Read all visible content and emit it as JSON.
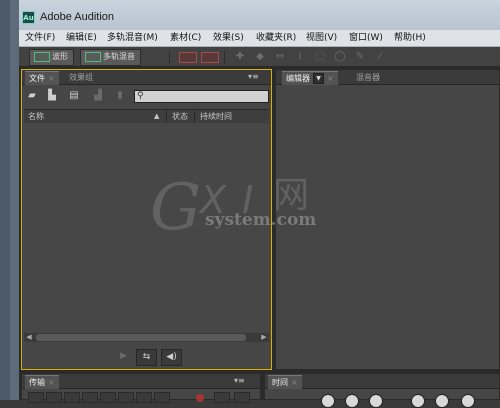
{
  "window": {
    "title": "Adobe Audition",
    "icon_text": "Au"
  },
  "menu": [
    {
      "id": "file",
      "label": "文件(F)"
    },
    {
      "id": "edit",
      "label": "编辑(E)"
    },
    {
      "id": "multitrack",
      "label": "多轨混音(M)"
    },
    {
      "id": "clip",
      "label": "素材(C)"
    },
    {
      "id": "effects",
      "label": "效果(S)"
    },
    {
      "id": "favorites",
      "label": "收藏夹(R)"
    },
    {
      "id": "view",
      "label": "视图(V)"
    },
    {
      "id": "window",
      "label": "窗口(W)"
    },
    {
      "id": "help",
      "label": "帮助(H)"
    }
  ],
  "toolbar": {
    "waveform_label": "波形",
    "multitrack_label": "多轨混音",
    "icons": [
      "spectral-frequency-icon",
      "spectral-pitch-icon",
      "move-tool-icon",
      "razor-tool-icon",
      "slip-tool-icon",
      "time-selection-icon",
      "marquee-tool-icon",
      "lasso-tool-icon",
      "brush-tool-icon",
      "spot-healing-icon"
    ]
  },
  "files_panel": {
    "tabs": [
      {
        "label": "文件",
        "active": true
      },
      {
        "label": "效果组",
        "active": false
      }
    ],
    "panel_menu": "▾≡",
    "tool_icons": [
      "open-folder-icon",
      "import-icon",
      "new-file-icon",
      "insert-icon",
      "delete-icon"
    ],
    "search_placeholder": "",
    "columns": {
      "name": "名称",
      "status": "状态",
      "duration": "持续时间"
    },
    "bottom_buttons": [
      "play-icon",
      "loop-icon",
      "autoplay-icon"
    ]
  },
  "editor_panel": {
    "tabs": [
      {
        "label": "编辑器",
        "active": true
      },
      {
        "label": "混音器",
        "active": false
      }
    ]
  },
  "transport_panel": {
    "tab_label": "传输",
    "panel_menu": "▾≡"
  },
  "time_panel": {
    "tab_label": "时间"
  },
  "watermark": {
    "big_g": "G",
    "xi": "X I",
    "net": "网",
    "domain": "system.com"
  }
}
